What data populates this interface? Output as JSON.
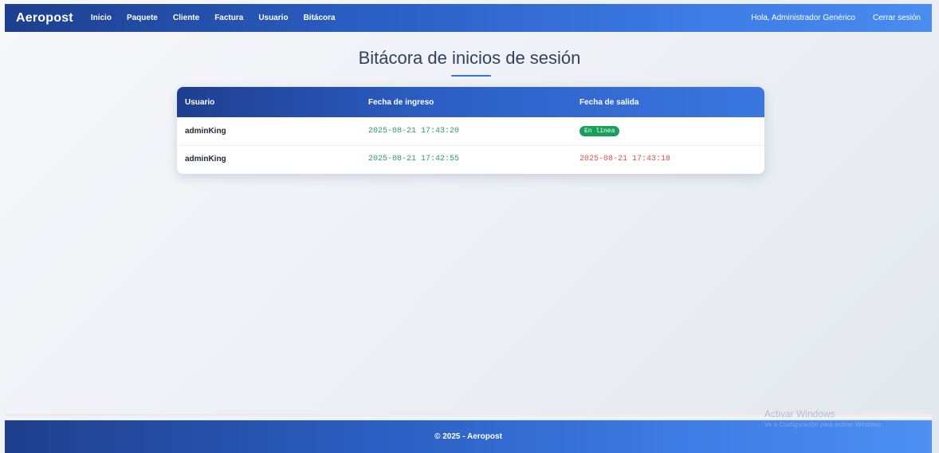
{
  "navbar": {
    "brand": "Aeropost",
    "links": [
      "Inicio",
      "Paquete",
      "Cliente",
      "Factura",
      "Usuario",
      "Bitácora"
    ],
    "greeting": "Hola, Administrador Genérico",
    "logout": "Cerrar sesión"
  },
  "page": {
    "title": "Bitácora de inicios de sesión"
  },
  "table": {
    "headers": [
      "Usuario",
      "Fecha de ingreso",
      "Fecha de salida"
    ],
    "rows": [
      {
        "user": "adminKing",
        "login": "2025-08-21 17:43:20",
        "logout_badge": "En línea"
      },
      {
        "user": "adminKing",
        "login": "2025-08-21 17:42:55",
        "logout": "2025-08-21 17:43:18"
      }
    ]
  },
  "footer": {
    "copyright": "© 2025 - Aeropost"
  },
  "watermark": {
    "title": "Activar Windows",
    "subtitle": "Ve a Configuración para activar Windows."
  },
  "colors": {
    "accent": "#2c5fc6",
    "online_badge": "#18a05a",
    "login_time": "#2e9c6a",
    "logout_time": "#d9534f"
  }
}
